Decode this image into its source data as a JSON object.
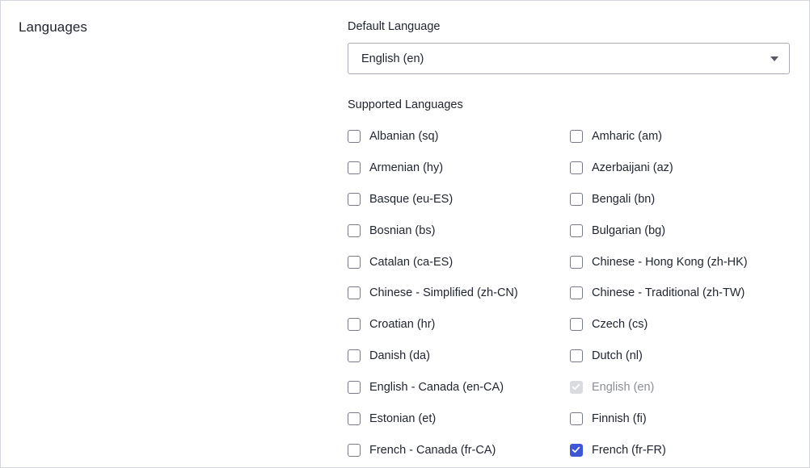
{
  "section": {
    "title": "Languages"
  },
  "default_language": {
    "label": "Default Language",
    "selected": "English (en)"
  },
  "supported_languages": {
    "label": "Supported Languages",
    "options": [
      {
        "label": "Albanian (sq)",
        "checked": false,
        "disabled": false
      },
      {
        "label": "Amharic (am)",
        "checked": false,
        "disabled": false
      },
      {
        "label": "Armenian (hy)",
        "checked": false,
        "disabled": false
      },
      {
        "label": "Azerbaijani (az)",
        "checked": false,
        "disabled": false
      },
      {
        "label": "Basque (eu-ES)",
        "checked": false,
        "disabled": false
      },
      {
        "label": "Bengali (bn)",
        "checked": false,
        "disabled": false
      },
      {
        "label": "Bosnian (bs)",
        "checked": false,
        "disabled": false
      },
      {
        "label": "Bulgarian (bg)",
        "checked": false,
        "disabled": false
      },
      {
        "label": "Catalan (ca-ES)",
        "checked": false,
        "disabled": false
      },
      {
        "label": "Chinese - Hong Kong (zh-HK)",
        "checked": false,
        "disabled": false
      },
      {
        "label": "Chinese - Simplified (zh-CN)",
        "checked": false,
        "disabled": false
      },
      {
        "label": "Chinese - Traditional (zh-TW)",
        "checked": false,
        "disabled": false
      },
      {
        "label": "Croatian (hr)",
        "checked": false,
        "disabled": false
      },
      {
        "label": "Czech (cs)",
        "checked": false,
        "disabled": false
      },
      {
        "label": "Danish (da)",
        "checked": false,
        "disabled": false
      },
      {
        "label": "Dutch (nl)",
        "checked": false,
        "disabled": false
      },
      {
        "label": "English - Canada (en-CA)",
        "checked": false,
        "disabled": false
      },
      {
        "label": "English (en)",
        "checked": true,
        "disabled": true
      },
      {
        "label": "Estonian (et)",
        "checked": false,
        "disabled": false
      },
      {
        "label": "Finnish (fi)",
        "checked": false,
        "disabled": false
      },
      {
        "label": "French - Canada (fr-CA)",
        "checked": false,
        "disabled": false
      },
      {
        "label": "French (fr-FR)",
        "checked": true,
        "disabled": false
      }
    ]
  },
  "colors": {
    "accent": "#3d57d6",
    "disabled_fill": "#d9dbde",
    "border": "#a9adb5",
    "text": "#1f2430"
  },
  "icons": {
    "dropdown": "chevron-down-icon",
    "checkmark": "checkmark-icon"
  }
}
